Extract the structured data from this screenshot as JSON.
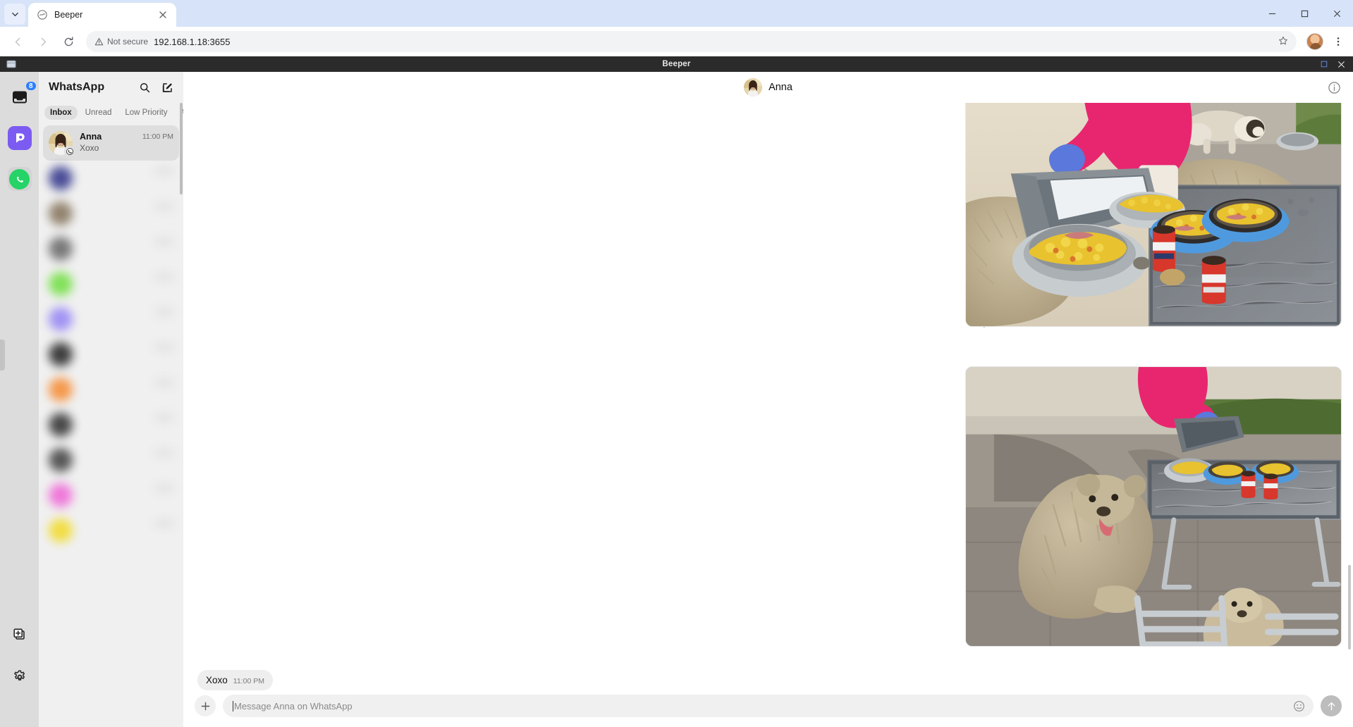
{
  "browser": {
    "tab": {
      "title": "Beeper",
      "favicon_icon": "beeper-favicon",
      "close_icon": "close-icon"
    },
    "tab_search_icon": "chevron-down-icon",
    "nav": {
      "back_icon": "arrow-left-icon",
      "forward_icon": "arrow-right-icon",
      "reload_icon": "reload-icon"
    },
    "omnibox": {
      "security_label": "Not secure",
      "security_icon": "warning-triangle-icon",
      "url": "192.168.1.18:3655",
      "bookmark_icon": "star-icon"
    },
    "profile_icon": "profile-avatar",
    "menu_icon": "kebab-menu-icon",
    "window": {
      "minimize_icon": "minimize-icon",
      "maximize_icon": "maximize-icon",
      "close_icon": "close-icon"
    }
  },
  "app": {
    "titlebar": {
      "title": "Beeper",
      "app_icon": "window-icon",
      "maximize_icon": "maximize-icon",
      "close_icon": "close-icon"
    },
    "rail": {
      "items": [
        {
          "name": "inbox",
          "icon": "inbox-icon",
          "badge": "8"
        },
        {
          "name": "beeper",
          "icon": "beeper-logo-icon"
        },
        {
          "name": "whatsapp",
          "icon": "whatsapp-icon"
        }
      ],
      "bottom_items": [
        {
          "name": "add-account",
          "icon": "add-account-icon"
        },
        {
          "name": "settings",
          "icon": "gear-icon"
        }
      ]
    },
    "chatlist": {
      "title": "WhatsApp",
      "search_icon": "search-icon",
      "compose_icon": "compose-icon",
      "tabs": [
        {
          "label": "Inbox",
          "active": true
        },
        {
          "label": "Unread",
          "active": false
        },
        {
          "label": "Low Priority",
          "active": false
        },
        {
          "label": "Archive",
          "active": false
        }
      ],
      "selected_chat": {
        "name": "Anna",
        "preview": "Xoxo",
        "time": "11:00 PM",
        "platform_icon": "whatsapp-icon",
        "avatar": "anna-avatar"
      },
      "blurred_chats": [
        {
          "avatar_color": "#3b3f8f"
        },
        {
          "avatar_color": "#8a7a63"
        },
        {
          "avatar_color": "#6f6f6f"
        },
        {
          "avatar_color": "#77e04a"
        },
        {
          "avatar_color": "#9a8bf5"
        },
        {
          "avatar_color": "#2e2e2e"
        },
        {
          "avatar_color": "#f6913e"
        },
        {
          "avatar_color": "#3a3a3a"
        },
        {
          "avatar_color": "#4a4a4a"
        },
        {
          "avatar_color": "#ef6fd8"
        },
        {
          "avatar_color": "#f2dc35"
        }
      ]
    },
    "conversation": {
      "title": "Anna",
      "avatar": "anna-avatar",
      "info_icon": "info-icon",
      "reply_icon": "reply-arrow-icon",
      "attachments": [
        {
          "name": "photo-dogs-feeding-top",
          "alt": "Person in pink sweater with blue gloves pouring food into dog bowls on a glass patio table"
        },
        {
          "name": "photo-dogs-feeding-bottom",
          "alt": "Shaggy dog sitting on a chair next to a glass table with bowls of food and red cans"
        }
      ],
      "last_message": {
        "text": "Xoxo",
        "time": "11:00 PM"
      },
      "composer": {
        "placeholder": "Message Anna on WhatsApp",
        "value": "",
        "add_icon": "plus-icon",
        "emoji_icon": "emoji-icon",
        "send_icon": "send-arrow-icon"
      }
    }
  },
  "colors": {
    "accent_blue": "#2b7fff",
    "beeper_purple": "#7b5bf2",
    "whatsapp_green": "#25d366",
    "titlebar_dark": "#2b2b2b",
    "rail_gray": "#dcdcdc",
    "chatlist_gray": "#f0f0f0"
  }
}
